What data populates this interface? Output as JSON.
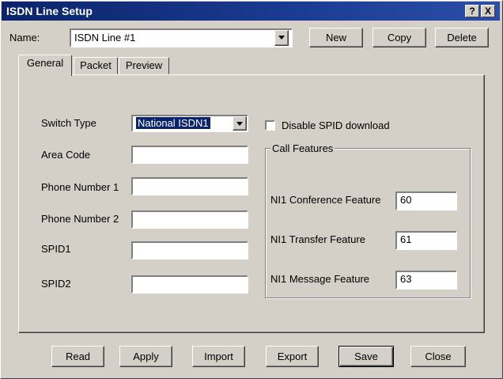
{
  "window": {
    "title": "ISDN Line Setup",
    "help_label": "?",
    "close_label": "X"
  },
  "name_row": {
    "label": "Name:",
    "value": "ISDN Line #1",
    "new_label": "New",
    "copy_label": "Copy",
    "delete_label": "Delete"
  },
  "tabs": [
    {
      "label": "General"
    },
    {
      "label": "Packet"
    },
    {
      "label": "Preview"
    }
  ],
  "general": {
    "switch_type_label": "Switch Type",
    "switch_type_value": "National ISDN1",
    "area_code_label": "Area Code",
    "area_code_value": "",
    "phone1_label": "Phone Number 1",
    "phone1_value": "",
    "phone2_label": "Phone Number 2",
    "phone2_value": "",
    "spid1_label": "SPID1",
    "spid1_value": "",
    "spid2_label": "SPID2",
    "spid2_value": "",
    "disable_spid_label": "Disable SPID download",
    "call_features": {
      "title": "Call Features",
      "conference_label": "NI1 Conference Feature",
      "conference_value": "60",
      "transfer_label": "NI1 Transfer Feature",
      "transfer_value": "61",
      "message_label": "NI1 Message Feature",
      "message_value": "63"
    }
  },
  "footer": {
    "read_label": "Read",
    "apply_label": "Apply",
    "import_label": "Import",
    "export_label": "Export",
    "save_label": "Save",
    "close_label": "Close"
  }
}
